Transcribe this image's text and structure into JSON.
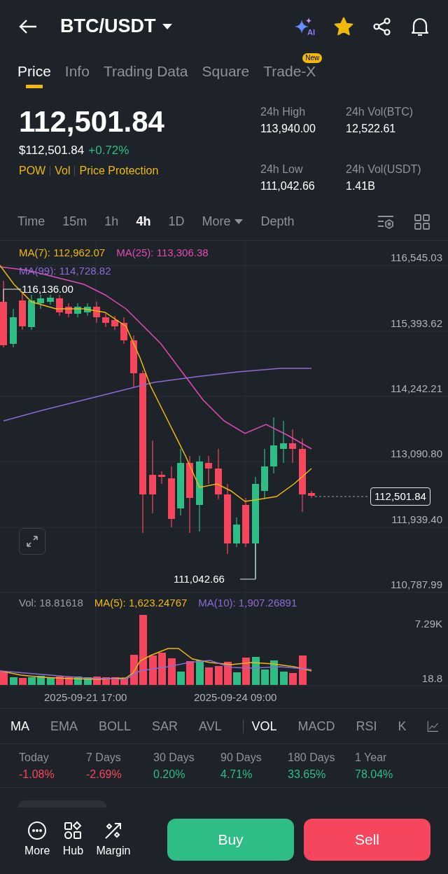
{
  "header": {
    "pair": "BTC/USDT",
    "ai_label": "AI",
    "favorite": true
  },
  "tabs": [
    {
      "label": "Price",
      "selected": true
    },
    {
      "label": "Info",
      "selected": false
    },
    {
      "label": "Trading Data",
      "selected": false
    },
    {
      "label": "Square",
      "selected": false
    },
    {
      "label": "Trade-X",
      "selected": false,
      "badge": "New"
    }
  ],
  "price": {
    "last": "112,501.84",
    "fiat": "$112,501.84",
    "change": "+0.72%",
    "tags": [
      "POW",
      "Vol",
      "Price Protection"
    ]
  },
  "stats": [
    {
      "label": "24h High",
      "value": "113,940.00"
    },
    {
      "label": "24h Vol(BTC)",
      "value": "12,522.61"
    },
    {
      "label": "24h Low",
      "value": "111,042.66"
    },
    {
      "label": "24h Vol(USDT)",
      "value": "1.41B"
    }
  ],
  "intervals": [
    {
      "label": "Time",
      "selected": false,
      "kind": "text"
    },
    {
      "label": "15m",
      "selected": false,
      "kind": "text"
    },
    {
      "label": "1h",
      "selected": false,
      "kind": "text"
    },
    {
      "label": "4h",
      "selected": true,
      "kind": "text"
    },
    {
      "label": "1D",
      "selected": false,
      "kind": "text"
    },
    {
      "label": "More",
      "selected": false,
      "kind": "dropdown"
    },
    {
      "label": "Depth",
      "selected": false,
      "kind": "text"
    }
  ],
  "chart": {
    "ma_labels": [
      {
        "text": "MA(7): 112,962.07",
        "color": "#f0b90b"
      },
      {
        "text": "MA(25): 113,306.38",
        "color": "#e14bb7"
      },
      {
        "text": "MA(99): 114,728.82",
        "color": "#8e6bd6"
      }
    ],
    "y_axis": [
      "116,545.03",
      "115,393.62",
      "114,242.21",
      "113,090.80",
      "111,939.40",
      "110,787.99"
    ],
    "high_marker": "116,136.00",
    "low_marker": "111,042.66",
    "current_price": "112,501.84"
  },
  "volume": {
    "labels": [
      {
        "text": "Vol: 18.81618",
        "color": "#9aa0ab"
      },
      {
        "text": "MA(5): 1,623.24767",
        "color": "#f0b90b"
      },
      {
        "text": "MA(10): 1,907.26891",
        "color": "#8e6bd6"
      }
    ],
    "y_axis": [
      "7.29K",
      "18.8"
    ],
    "x_axis": [
      "2025-09-21 17:00",
      "2025-09-24 09:00"
    ]
  },
  "indicators": [
    {
      "label": "MA",
      "selected": true
    },
    {
      "label": "EMA",
      "selected": false
    },
    {
      "label": "BOLL",
      "selected": false
    },
    {
      "label": "SAR",
      "selected": false
    },
    {
      "label": "AVL",
      "selected": false
    },
    {
      "label": "VOL",
      "selected": true
    },
    {
      "label": "MACD",
      "selected": false
    },
    {
      "label": "RSI",
      "selected": false
    },
    {
      "label": "K",
      "selected": false
    }
  ],
  "performance": [
    {
      "label": "Today",
      "value": "-1.08%",
      "color": "#f6465d"
    },
    {
      "label": "7 Days",
      "value": "-2.69%",
      "color": "#f6465d"
    },
    {
      "label": "30 Days",
      "value": "0.20%",
      "color": "#2ebd85"
    },
    {
      "label": "90 Days",
      "value": "4.71%",
      "color": "#2ebd85"
    },
    {
      "label": "180 Days",
      "value": "33.65%",
      "color": "#2ebd85"
    },
    {
      "label": "1 Year",
      "value": "78.04%",
      "color": "#2ebd85"
    }
  ],
  "actions": [
    {
      "label": "More",
      "kind": "more"
    },
    {
      "label": "Hub",
      "kind": "hub"
    },
    {
      "label": "Margin",
      "kind": "margin"
    }
  ],
  "trade_buttons": [
    {
      "label": "Buy",
      "kind": "buy"
    },
    {
      "label": "Sell",
      "kind": "sell"
    }
  ]
}
